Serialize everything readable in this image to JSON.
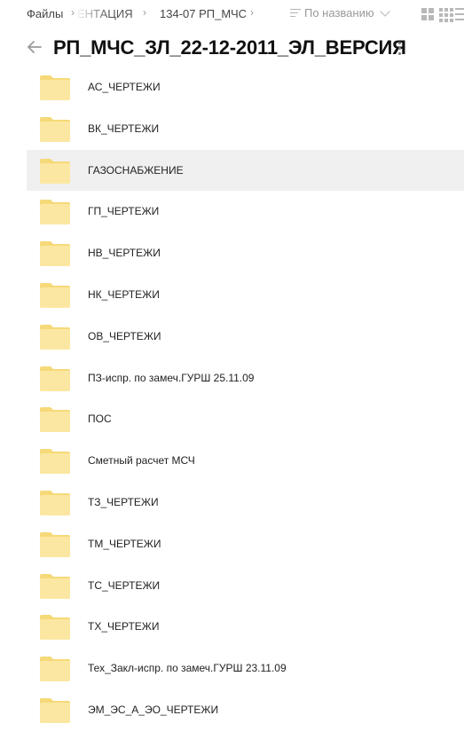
{
  "breadcrumb": {
    "root": "Файлы",
    "middle": "ЕНТАЦИЯ",
    "current": "134-07 РП_МЧС",
    "separator": "›"
  },
  "sort": {
    "label": "По названию"
  },
  "title": "РП_МЧС_ЗЛ_22-12-2011_ЭЛ_ВЕРСИЯ",
  "colors": {
    "folder": "#fbe7a1",
    "folder_tab": "#f6d978",
    "selected_row": "#f0f0f0"
  },
  "files": [
    {
      "name": "АС_ЧЕРТЕЖИ",
      "type": "folder"
    },
    {
      "name": "ВК_ЧЕРТЕЖИ",
      "type": "folder"
    },
    {
      "name": "ГАЗОСНАБЖЕНИЕ",
      "type": "folder",
      "selected": true
    },
    {
      "name": "ГП_ЧЕРТЕЖИ",
      "type": "folder"
    },
    {
      "name": "НВ_ЧЕРТЕЖИ",
      "type": "folder"
    },
    {
      "name": "НК_ЧЕРТЕЖИ",
      "type": "folder"
    },
    {
      "name": "ОВ_ЧЕРТЕЖИ",
      "type": "folder"
    },
    {
      "name": "ПЗ-испр. по замеч.ГУРШ 25.11.09",
      "type": "folder"
    },
    {
      "name": "ПОС",
      "type": "folder"
    },
    {
      "name": "Сметный расчет МСЧ",
      "type": "folder"
    },
    {
      "name": "ТЗ_ЧЕРТЕЖИ",
      "type": "folder"
    },
    {
      "name": "ТМ_ЧЕРТЕЖИ",
      "type": "folder"
    },
    {
      "name": "ТС_ЧЕРТЕЖИ",
      "type": "folder"
    },
    {
      "name": "ТХ_ЧЕРТЕЖИ",
      "type": "folder"
    },
    {
      "name": "Тех_Закл-испр. по замеч.ГУРШ 23.11.09",
      "type": "folder"
    },
    {
      "name": "ЭМ_ЭС_А_ЭО_ЧЕРТЕЖИ",
      "type": "folder"
    }
  ]
}
